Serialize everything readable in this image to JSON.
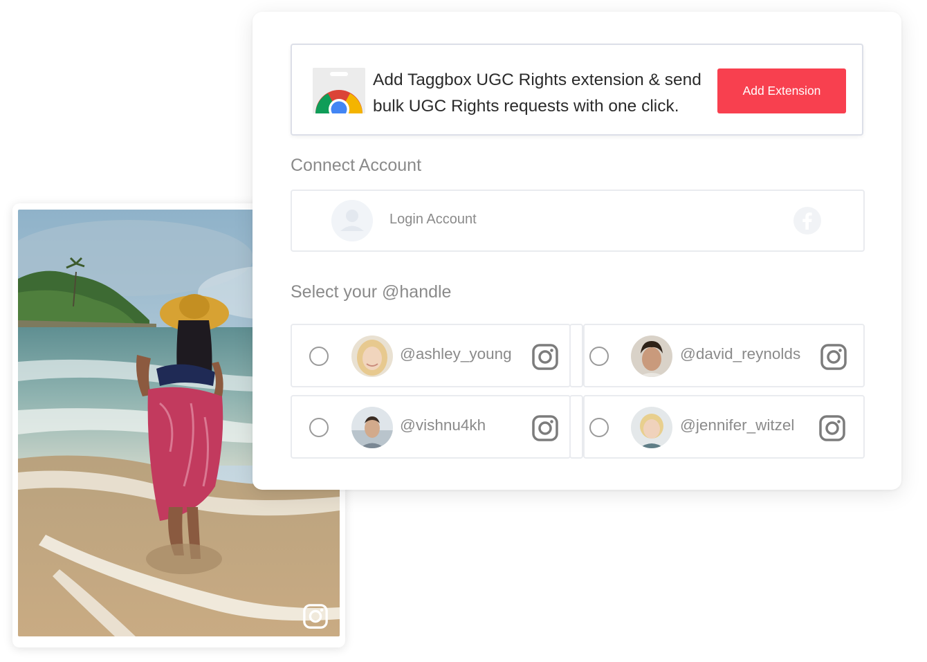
{
  "extension_banner": {
    "icon": "chrome-web-store-icon",
    "text": "Add Taggbox UGC Rights extension & send bulk UGC Rights requests with one click.",
    "button_label": "Add Extension",
    "button_color": "#f8404f"
  },
  "connect_account": {
    "title": "Connect Account",
    "login_label": "Login Account",
    "provider_icon": "facebook-icon"
  },
  "select_handle": {
    "title": "Select your @handle",
    "handles": [
      {
        "name": "@ashley_young",
        "network_icon": "instagram-icon"
      },
      {
        "name": "@david_reynolds",
        "network_icon": "instagram-icon"
      },
      {
        "name": "@vishnu4kh",
        "network_icon": "instagram-icon"
      },
      {
        "name": "@jennifer_witzel",
        "network_icon": "instagram-icon"
      }
    ]
  },
  "photo_card": {
    "network_icon": "instagram-icon"
  }
}
